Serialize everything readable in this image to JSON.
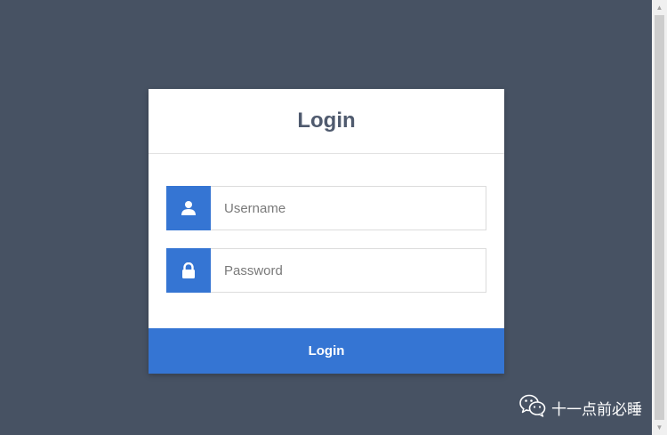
{
  "login_card": {
    "title": "Login",
    "username": {
      "placeholder": "Username",
      "value": ""
    },
    "password": {
      "placeholder": "Password",
      "value": ""
    },
    "submit_label": "Login"
  },
  "watermark": {
    "text": "十一点前必睡"
  },
  "icons": {
    "username": "user-icon",
    "password": "lock-icon",
    "watermark": "wechat-icon"
  },
  "colors": {
    "background": "#475263",
    "accent": "#3575d3",
    "title": "#4f5a6e"
  }
}
